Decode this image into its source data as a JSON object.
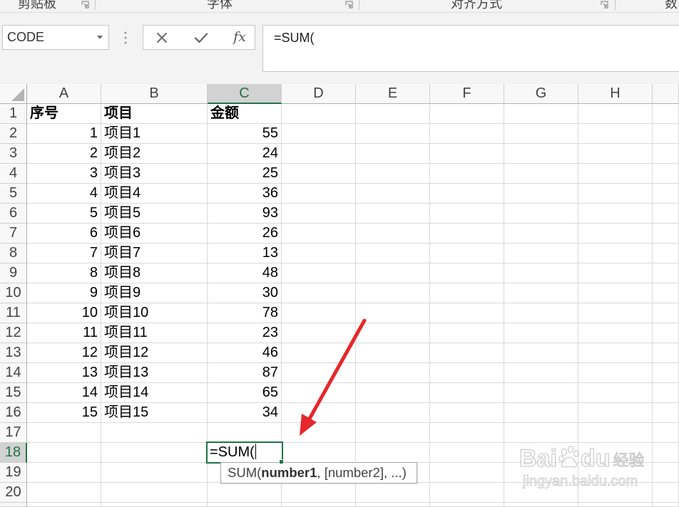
{
  "ribbon": {
    "groups": [
      {
        "label": "剪贴板"
      },
      {
        "label": "字体"
      },
      {
        "label": "对齐方式"
      },
      {
        "label": "数"
      }
    ]
  },
  "formula_bar": {
    "name_box": "CODE",
    "fx_label": "fx",
    "formula": "=SUM(",
    "icons": [
      "chevron-down-icon",
      "splitter-grip-icon",
      "cancel-icon",
      "enter-icon",
      "insert-function-icon",
      "dialog-launcher-icon"
    ]
  },
  "sheet": {
    "columns": [
      {
        "label": "A"
      },
      {
        "label": "B"
      },
      {
        "label": "C",
        "selected": true
      },
      {
        "label": "D"
      },
      {
        "label": "E"
      },
      {
        "label": "F"
      },
      {
        "label": "G"
      },
      {
        "label": "H"
      }
    ],
    "row_headers": [
      {
        "label": "1"
      },
      {
        "label": "2"
      },
      {
        "label": "3"
      },
      {
        "label": "4"
      },
      {
        "label": "5"
      },
      {
        "label": "6"
      },
      {
        "label": "7"
      },
      {
        "label": "8"
      },
      {
        "label": "9"
      },
      {
        "label": "10"
      },
      {
        "label": "11"
      },
      {
        "label": "12"
      },
      {
        "label": "13"
      },
      {
        "label": "14"
      },
      {
        "label": "15"
      },
      {
        "label": "16"
      },
      {
        "label": "17"
      },
      {
        "label": "18",
        "selected": true
      },
      {
        "label": "19"
      },
      {
        "label": "20"
      }
    ],
    "cells": [
      [
        "序号",
        "项目",
        "金额"
      ],
      [
        1,
        "项目1",
        55
      ],
      [
        2,
        "项目2",
        24
      ],
      [
        3,
        "项目3",
        25
      ],
      [
        4,
        "项目4",
        36
      ],
      [
        5,
        "项目5",
        93
      ],
      [
        6,
        "项目6",
        26
      ],
      [
        7,
        "项目7",
        13
      ],
      [
        8,
        "项目8",
        48
      ],
      [
        9,
        "项目9",
        30
      ],
      [
        10,
        "项目10",
        78
      ],
      [
        11,
        "项目11",
        23
      ],
      [
        12,
        "项目12",
        46
      ],
      [
        13,
        "项目13",
        87
      ],
      [
        14,
        "项目14",
        65
      ],
      [
        15,
        "项目15",
        34
      ]
    ],
    "active_cell": {
      "value": "=SUM("
    },
    "tooltip": {
      "function": "SUM(",
      "current_argument": "number1",
      "remaining": ", [number2], ...)"
    }
  },
  "watermark": {
    "brand_left": "Bai",
    "brand_right": "du",
    "brand_cn": "经验",
    "url": "jingyan.baidu.com"
  },
  "colors": {
    "accent": "#217346",
    "annotation_arrow": "#e5282a",
    "gridline": "#d9d9d9",
    "selected_header": "#d2d2d2"
  }
}
